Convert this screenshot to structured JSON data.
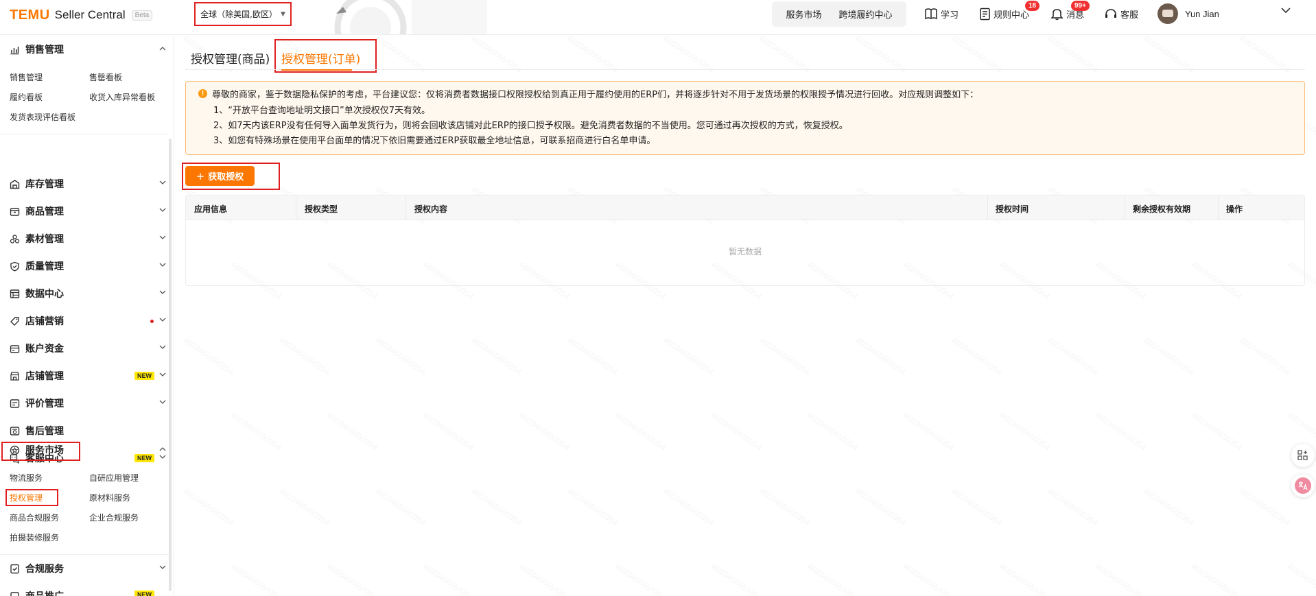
{
  "header": {
    "logo_brand": "TEMU",
    "logo_product": "Seller Central",
    "logo_badge": "Beta",
    "region_selector": "全球（除美国,欧区）",
    "pill_links": [
      "服务市场",
      "跨境履约中心"
    ],
    "nav": {
      "learn": "学习",
      "rules": "规则中心",
      "rules_badge": "18",
      "messages": "消息",
      "messages_badge": "99+",
      "service": "客服"
    },
    "user_name": "Yun Jian"
  },
  "sidebar": {
    "sales_group": {
      "label": "销售管理",
      "items": [
        "销售管理",
        "售罄看板",
        "履约看板",
        "收货入库异常看板",
        "发货表现评估看板"
      ]
    },
    "menus": [
      {
        "label": "库存管理",
        "icon": "warehouse-icon"
      },
      {
        "label": "商品管理",
        "icon": "box-icon"
      },
      {
        "label": "素材管理",
        "icon": "material-icon"
      },
      {
        "label": "质量管理",
        "icon": "shield-icon"
      },
      {
        "label": "数据中心",
        "icon": "data-icon"
      },
      {
        "label": "店铺营销",
        "icon": "tag-icon",
        "dot": true
      },
      {
        "label": "账户资金",
        "icon": "wallet-icon"
      },
      {
        "label": "店铺管理",
        "icon": "store-icon",
        "badge": "NEW"
      },
      {
        "label": "评价管理",
        "icon": "review-icon"
      },
      {
        "label": "售后管理",
        "icon": "aftersale-icon"
      },
      {
        "label": "客服中心",
        "icon": "chat-icon",
        "badge": "NEW"
      }
    ],
    "service_market": {
      "label": "服务市场",
      "items": [
        "物流服务",
        "自研应用管理",
        "授权管理",
        "原材料服务",
        "商品合规服务",
        "企业合规服务",
        "拍摄装修服务"
      ],
      "active": "授权管理"
    },
    "compliance": {
      "label": "合规服务"
    },
    "promo": {
      "label": "商品推广",
      "badge": "NEW"
    }
  },
  "main": {
    "tabs": [
      "授权管理(商品)",
      "授权管理(订单)"
    ],
    "active_tab": "授权管理(订单)",
    "notice": {
      "icon": "!",
      "lines": [
        "尊敬的商家，鉴于数据隐私保护的考虑，平台建议您：仅将消费者数据接口权限授权给到真正用于履约使用的ERP们，并将逐步针对不用于发货场景的权限授予情况进行回收。对应规则调整如下：",
        "1、“开放平台查询地址明文接口”单次授权仅7天有效。",
        "2、如7天内该ERP没有任何导入面单发货行为，则将会回收该店铺对此ERP的接口授予权限。避免消费者数据的不当使用。您可通过再次授权的方式，恢复授权。",
        "3、如您有特殊场景在使用平台面单的情况下依旧需要通过ERP获取最全地址信息，可联系招商进行白名单申请。"
      ]
    },
    "get_auth_button": "获取授权",
    "table": {
      "columns": [
        "应用信息",
        "授权类型",
        "授权内容",
        "授权时间",
        "剩余授权有效期",
        "操作"
      ],
      "empty_text": "暂无数据"
    }
  },
  "watermark": "4603466650354",
  "colors": {
    "accent": "#fb7701",
    "highlight_box": "#e02020",
    "notice_bg": "#fff8ee"
  }
}
